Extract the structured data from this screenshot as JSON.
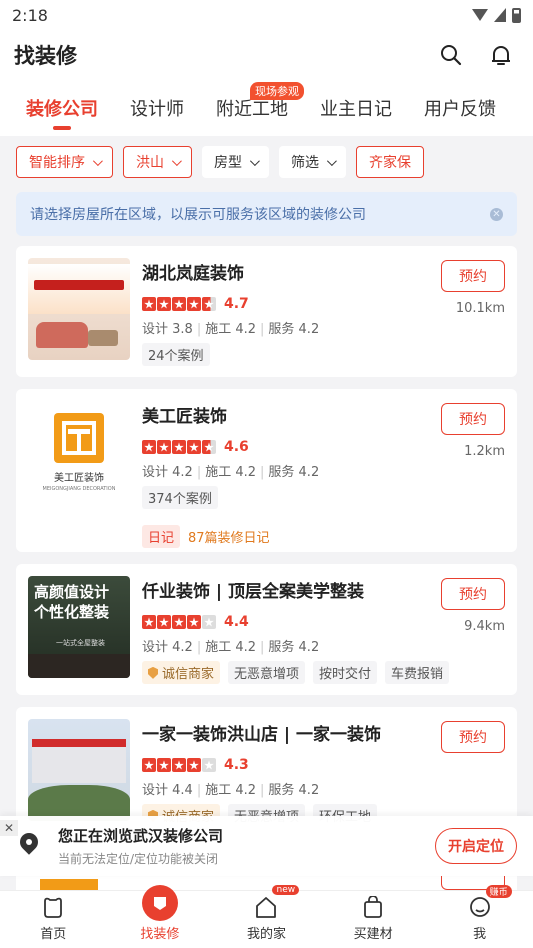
{
  "status": {
    "time": "2:18"
  },
  "app": {
    "title": "找装修"
  },
  "tabs": [
    {
      "label": "装修公司",
      "active": true
    },
    {
      "label": "设计师"
    },
    {
      "label": "附近工地",
      "badge": "现场参观"
    },
    {
      "label": "业主日记"
    },
    {
      "label": "用户反馈"
    }
  ],
  "filters": [
    {
      "label": "智能排序",
      "style": "red",
      "chevron": true
    },
    {
      "label": "洪山",
      "style": "red",
      "chevron": true
    },
    {
      "label": "房型",
      "chevron": true
    },
    {
      "label": "筛选",
      "chevron": true
    },
    {
      "label": "齐家保",
      "style": "red"
    }
  ],
  "notice": {
    "text": "请选择房屋所在区域，以展示可服务该区域的装修公司"
  },
  "companies": [
    {
      "name": "湖北岚庭装饰",
      "score": "4.7",
      "distance": "10.1km",
      "design": "设计 3.8",
      "build": "施工 4.2",
      "service": "服务 4.2",
      "tags": [
        "24个案例"
      ],
      "book": "预约"
    },
    {
      "name": "美工匠装饰",
      "score": "4.6",
      "distance": "1.2km",
      "design": "设计 4.2",
      "build": "施工 4.2",
      "service": "服务 4.2",
      "tags": [
        "374个案例"
      ],
      "diary_tag": "日记",
      "diary_text": "87篇装修日记",
      "logo_text": "美工匠装饰",
      "logo_en": "MEIGONGJIANG DECORATION",
      "book": "预约"
    },
    {
      "name": "仟业装饰 | 顶层全案美学整装",
      "score": "4.4",
      "distance": "9.4km",
      "design": "设计 4.2",
      "build": "施工 4.2",
      "service": "服务 4.2",
      "gold_tag": "诚信商家",
      "tags": [
        "无恶意增项",
        "按时交付",
        "车费报销"
      ],
      "thumb_head": "高颜值设计\n个性化整装",
      "thumb_small": "一站式全屋整装",
      "book": "预约"
    },
    {
      "name": "一家一装饰洪山店 | 一家一装饰",
      "score": "4.3",
      "design": "设计 4.4",
      "build": "施工 4.2",
      "service": "服务 4.2",
      "gold_tag": "诚信商家",
      "tags": [
        "无恶意增项",
        "环保工地"
      ],
      "book": "预约"
    }
  ],
  "location": {
    "title": "您正在浏览武汉装修公司",
    "sub": "当前无法定位/定位功能被关闭",
    "button": "开启定位"
  },
  "nav": [
    {
      "label": "首页",
      "icon": "home-icon"
    },
    {
      "label": "找装修",
      "icon": "find-renovation-icon",
      "active": true
    },
    {
      "label": "我的家",
      "icon": "house-icon",
      "badge": "new"
    },
    {
      "label": "买建材",
      "icon": "bag-icon"
    },
    {
      "label": "我",
      "icon": "profile-icon",
      "badge": "赚币"
    }
  ],
  "colors": {
    "accent": "#e8402f",
    "notice_bg": "#e5eefb"
  }
}
